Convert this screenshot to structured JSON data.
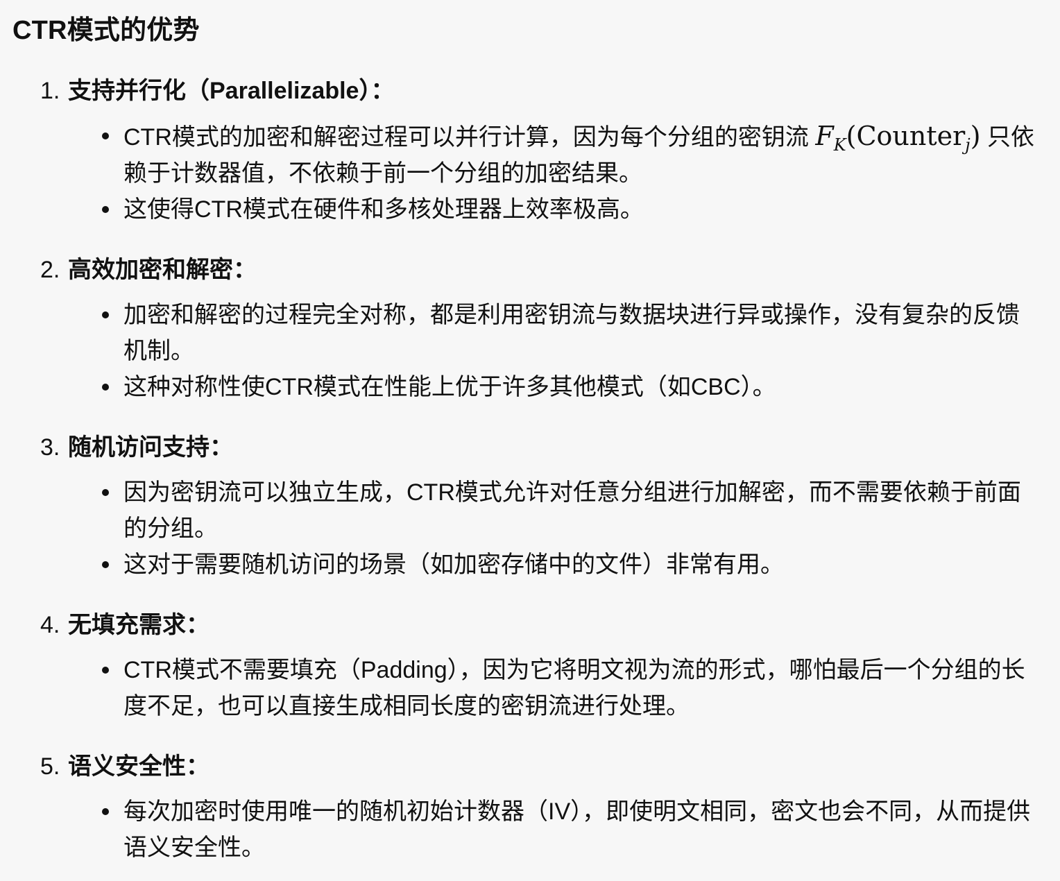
{
  "heading": "CTR模式的优势",
  "sections": [
    {
      "number": "1.",
      "title": "支持并行化（Parallelizable）：",
      "bullets": [
        {
          "before": "CTR模式的加密和解密过程可以并行计算，因为每个分组的密钥流 ",
          "math": {
            "F": "F",
            "K": "K",
            "counter": "(Counter",
            "j": "j",
            "close": ")"
          },
          "after": " 只依赖于计数器值，不依赖于前一个分组的加密结果。"
        },
        {
          "text": "这使得CTR模式在硬件和多核处理器上效率极高。"
        }
      ]
    },
    {
      "number": "2.",
      "title": "高效加密和解密：",
      "bullets": [
        {
          "text": "加密和解密的过程完全对称，都是利用密钥流与数据块进行异或操作，没有复杂的反馈机制。"
        },
        {
          "text": "这种对称性使CTR模式在性能上优于许多其他模式（如CBC）。"
        }
      ]
    },
    {
      "number": "3.",
      "title": "随机访问支持：",
      "bullets": [
        {
          "text": "因为密钥流可以独立生成，CTR模式允许对任意分组进行加解密，而不需要依赖于前面的分组。"
        },
        {
          "text": "这对于需要随机访问的场景（如加密存储中的文件）非常有用。"
        }
      ]
    },
    {
      "number": "4.",
      "title": "无填充需求：",
      "bullets": [
        {
          "text": "CTR模式不需要填充（Padding），因为它将明文视为流的形式，哪怕最后一个分组的长度不足，也可以直接生成相同长度的密钥流进行处理。"
        }
      ]
    },
    {
      "number": "5.",
      "title": "语义安全性：",
      "bullets": [
        {
          "text": "每次加密时使用唯一的随机初始计数器（IV），即使明文相同，密文也会不同，从而提供语义安全性。"
        }
      ]
    }
  ]
}
